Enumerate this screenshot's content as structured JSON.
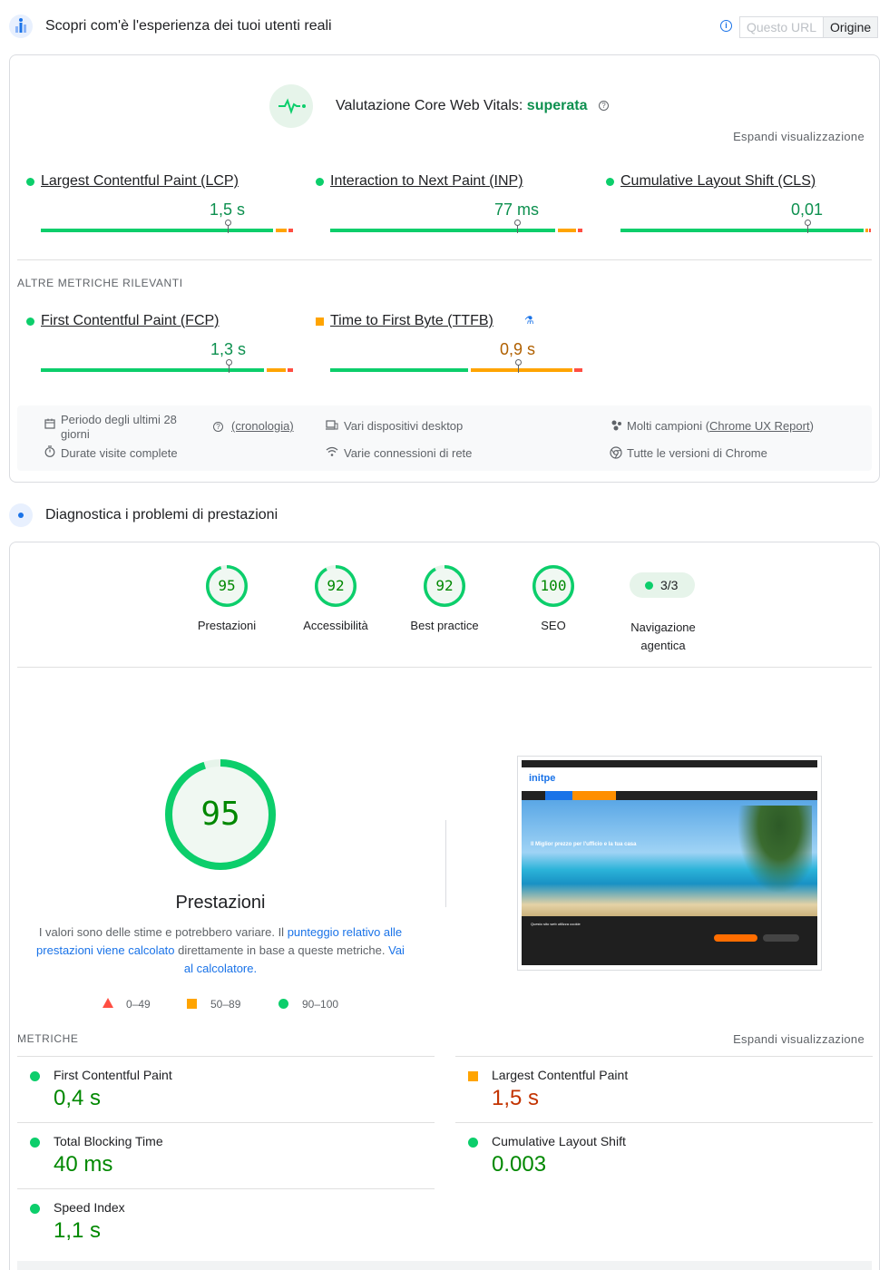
{
  "field": {
    "title": "Scopri com'è l'esperienza dei tuoi utenti reali",
    "toggle": {
      "url": "Questo URL",
      "origin": "Origine"
    },
    "cwv": {
      "label": "Valutazione Core Web Vitals:",
      "status": "superata"
    },
    "expand": "Espandi visualizzazione",
    "metrics": [
      {
        "label": "Largest Contentful Paint (LCP)",
        "value": "1,5 s",
        "rating": "good"
      },
      {
        "label": "Interaction to Next Paint (INP)",
        "value": "77 ms",
        "rating": "good"
      },
      {
        "label": "Cumulative Layout Shift (CLS)",
        "value": "0,01",
        "rating": "good"
      }
    ],
    "other_label": "ALTRE METRICHE RILEVANTI",
    "other_metrics": [
      {
        "label": "First Contentful Paint (FCP)",
        "value": "1,3 s",
        "rating": "good"
      },
      {
        "label": "Time to First Byte (TTFB)",
        "value": "0,9 s",
        "rating": "average"
      }
    ],
    "info": {
      "period": "Periodo degli ultimi 28 giorni",
      "history": "(cronologia)",
      "visits": "Durate visite complete",
      "devices": "Vari dispositivi desktop",
      "network": "Varie connessioni di rete",
      "samples_prefix": "Molti campioni (",
      "samples_link": "Chrome UX Report",
      "samples_suffix": ")",
      "chrome": "Tutte le versioni di Chrome"
    }
  },
  "lab": {
    "title": "Diagnostica i problemi di prestazioni",
    "scores": [
      {
        "label": "Prestazioni",
        "score": "95",
        "pct": 0.95
      },
      {
        "label": "Accessibilità",
        "score": "92",
        "pct": 0.92
      },
      {
        "label": "Best practice",
        "score": "92",
        "pct": 0.92
      },
      {
        "label": "SEO",
        "score": "100",
        "pct": 1.0
      }
    ],
    "agentic": {
      "value": "3/3",
      "label": "Navigazione agentica"
    },
    "main": {
      "score": "95",
      "pct": 0.95,
      "title": "Prestazioni",
      "desc_1": "I valori sono delle stime e potrebbero variare. Il ",
      "desc_link1": "punteggio relativo alle prestazioni viene calcolato",
      "desc_2": " direttamente in base a queste metriche. ",
      "desc_link2": "Vai al calcolatore."
    },
    "legend": {
      "poor": "0–49",
      "avg": "50–89",
      "good": "90–100"
    },
    "screenshot": {
      "logo": "initpe",
      "hero_text": "Il Miglior prezzo per l'ufficio e la tua casa",
      "cookie_text": "Questo sito web utilizza cookie"
    },
    "metrics_label": "METRICHE",
    "expand": "Espandi visualizzazione",
    "metrics": [
      {
        "label": "First Contentful Paint",
        "value": "0,4 s",
        "rating": "good"
      },
      {
        "label": "Largest Contentful Paint",
        "value": "1,5 s",
        "rating": "average"
      },
      {
        "label": "Total Blocking Time",
        "value": "40 ms",
        "rating": "good"
      },
      {
        "label": "Cumulative Layout Shift",
        "value": "0.003",
        "rating": "good"
      },
      {
        "label": "Speed Index",
        "value": "1,1 s",
        "rating": "good"
      }
    ]
  },
  "colors": {
    "good": "#0cce6b",
    "average": "#ffa400",
    "poor": "#ff4e42",
    "link": "#1a73e8"
  }
}
